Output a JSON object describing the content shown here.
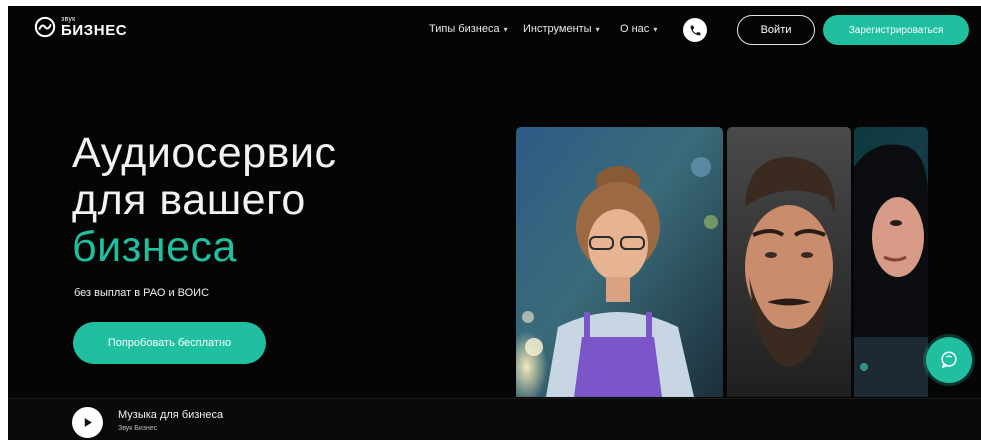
{
  "brand": {
    "small": "звук",
    "big": "БИЗНЕС"
  },
  "nav": [
    {
      "label": "Типы бизнеса"
    },
    {
      "label": "Инструменты"
    },
    {
      "label": "О нас"
    }
  ],
  "header": {
    "login_label": "Войти",
    "register_label": "Зарегистрироваться"
  },
  "hero": {
    "title_line1": "Аудиосервис",
    "title_line2": "для вашего",
    "title_accent": "бизнеса",
    "subtitle": "без выплат в РАО и ВОИС",
    "cta_label": "Попробовать бесплатно"
  },
  "player": {
    "title": "Музыка для бизнеса",
    "artist": "Звук Бизнес"
  },
  "icons": {
    "logo": "sound-wave-logo-icon",
    "phone": "phone-icon",
    "chat": "chat-icon",
    "play": "play-icon",
    "dropdown": "chevron-down-icon"
  },
  "colors": {
    "accent": "#1fbf9f",
    "background": "#050505",
    "text": "#f2f2f2"
  }
}
